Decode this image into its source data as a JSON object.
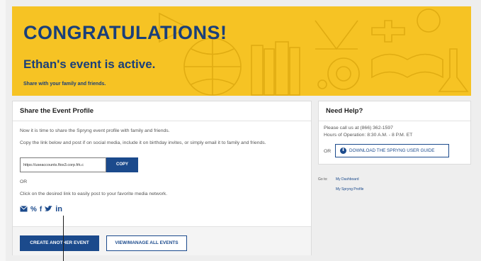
{
  "banner": {
    "title": "CONGRATULATIONS!",
    "subtitle": "Ethan's event is active.",
    "small_text": "Share with your family and friends."
  },
  "share": {
    "heading": "Share the Event Profile",
    "intro": "Now it is time to share the Spryng event profile with family and friends.",
    "instructions": "Copy the link below and post if on social media, include it on birthday invites, or simply email it to family and friends.",
    "link_value": "https://useaccounts.ftos3.corp.frk.c",
    "copy_label": "COPY",
    "or_label": "OR",
    "click_text": "Click on the desired link to easily post to your favorite media network.",
    "social_icons": [
      "email-icon",
      "link-icon",
      "facebook-icon",
      "twitter-icon",
      "linkedin-icon"
    ],
    "create_label": "CREATE ANOTHER EVENT",
    "manage_label": "VIEW/MANAGE ALL EVENTS"
  },
  "help": {
    "heading": "Need Help?",
    "phone_text": "Please call us at (866) 362-1597",
    "hours_text": "Hours of Operation: 8:30 A.M. - 8 P.M. ET",
    "or_label": "OR",
    "guide_label": "DOWNLOAD THE SPRYNG USER GUIDE"
  },
  "goto": {
    "label": "Go to:",
    "links": [
      "My Dashboard",
      "My Spryng Profile"
    ]
  },
  "colors": {
    "banner_yellow": "#f6c324",
    "brand_navy": "#1b4a8c",
    "title_blue": "#1a3f7a"
  }
}
